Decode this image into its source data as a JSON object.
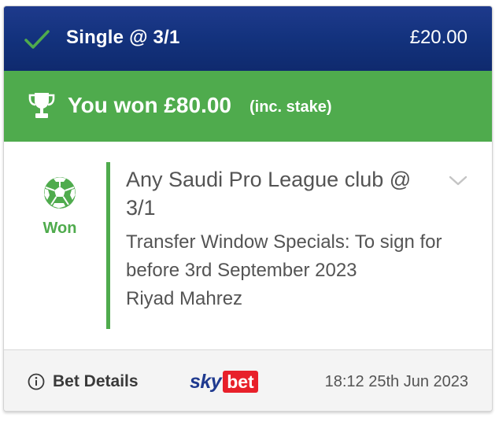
{
  "header": {
    "bet_type": "Single @ 3/1",
    "stake": "£20.00",
    "check_icon": "check-icon",
    "background_color": "#13327d"
  },
  "win_banner": {
    "won_text": "You won £80.00",
    "note": "(inc. stake)",
    "trophy_icon": "trophy-icon",
    "background_color": "#4fab4d"
  },
  "bet": {
    "sport_icon": "football-icon",
    "status": "Won",
    "selection": "Any Saudi Pro League club @ 3/1",
    "market": "Transfer Window Specials: To sign for before 3rd September 2023",
    "participant": "Riyad Mahrez",
    "expand_icon": "chevron-down-icon"
  },
  "footer": {
    "details_label": "Bet Details",
    "info_icon": "info-icon",
    "logo_sky": "sky",
    "logo_bet": "bet",
    "placed_at": "18:12 25th Jun 2023"
  }
}
